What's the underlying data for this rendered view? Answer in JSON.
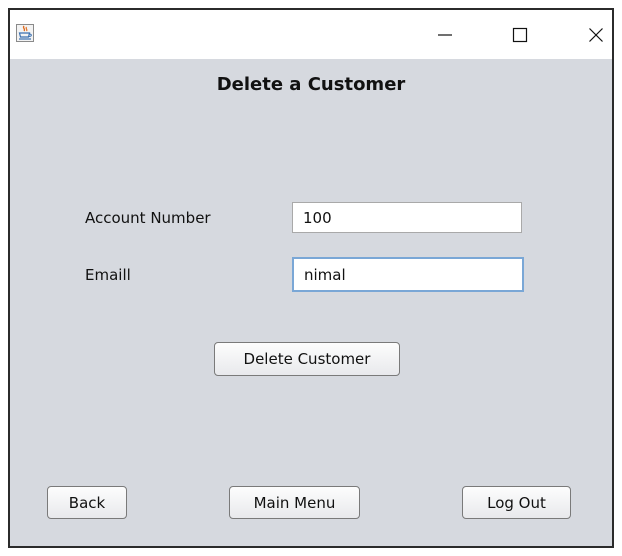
{
  "window": {
    "icon": "java-cup-icon",
    "controls": {
      "minimize_icon": "minimize-icon",
      "maximize_icon": "maximize-icon",
      "close_icon": "close-icon"
    }
  },
  "form": {
    "title": "Delete a Customer",
    "account_number_label": "Account Number",
    "account_number_value": "100",
    "email_label": "Emaill",
    "email_value": "nimal",
    "delete_button": "Delete Customer"
  },
  "footer": {
    "back_button": "Back",
    "main_menu_button": "Main Menu",
    "logout_button": "Log Out"
  },
  "colors": {
    "panel_background": "#d6d9df",
    "focus_border": "#7aa7d6"
  }
}
